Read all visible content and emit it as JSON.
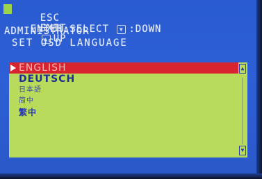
{
  "help": {
    "esc_key": "ESC",
    "exit_label": "EXIT",
    "up_label": "UP",
    "enter_key": "ENTER",
    "select_label": "SELECT",
    "down_label": "DOWN"
  },
  "title": {
    "role": "ADMINISTRATOR",
    "menu": "SET OSD LANGUAGE"
  },
  "languages": [
    {
      "label": "ENGLISH",
      "selected": true
    },
    {
      "label": "DEUTSCH",
      "selected": false
    },
    {
      "label": "日本語",
      "selected": false
    },
    {
      "label": "简中",
      "selected": false
    },
    {
      "label": "繁中",
      "selected": false
    }
  ],
  "colors": {
    "screen_bg": "#2d5fd6",
    "panel_bg": "#b9db5c",
    "selected_row": "#d8242f",
    "text_blue": "#1b2f97"
  }
}
